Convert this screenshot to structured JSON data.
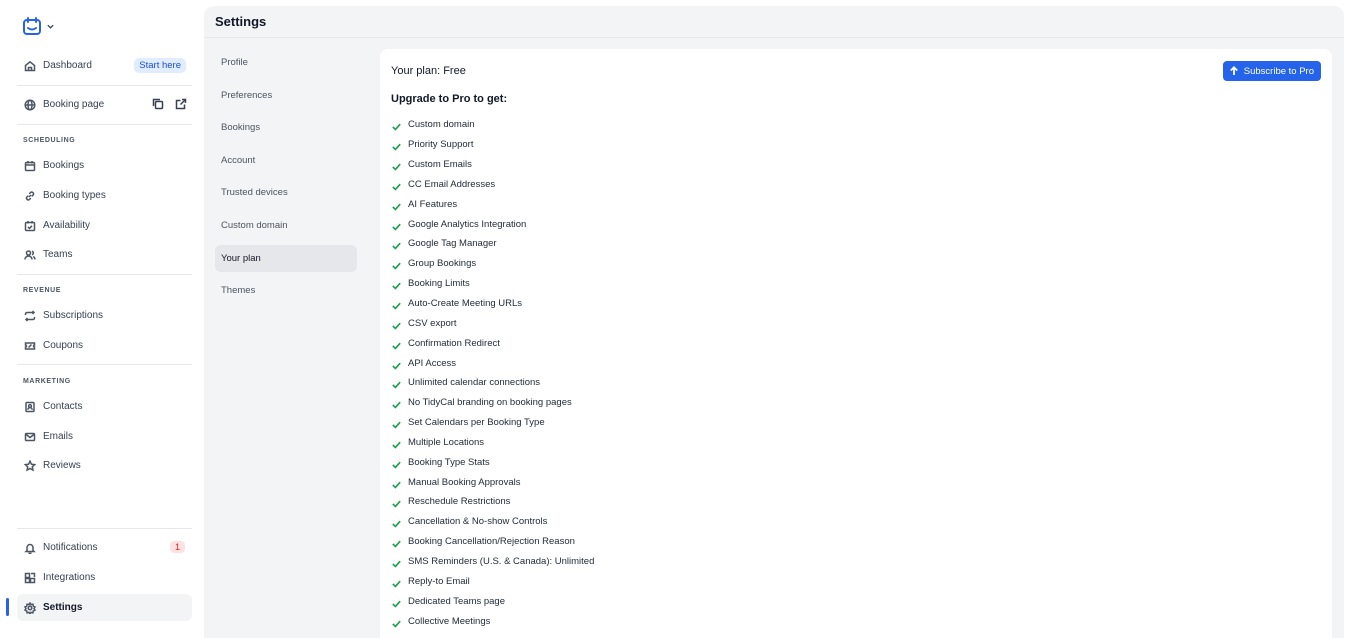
{
  "sidebar": {
    "dashboard": {
      "label": "Dashboard",
      "badge": "Start here"
    },
    "booking_page": {
      "label": "Booking page"
    },
    "sections": {
      "scheduling": "SCHEDULING",
      "revenue": "REVENUE",
      "marketing": "MARKETING"
    },
    "items": {
      "bookings": "Bookings",
      "booking_types": "Booking types",
      "availability": "Availability",
      "teams": "Teams",
      "subscriptions": "Subscriptions",
      "coupons": "Coupons",
      "contacts": "Contacts",
      "emails": "Emails",
      "reviews": "Reviews",
      "notifications": "Notifications",
      "notifications_count": "1",
      "integrations": "Integrations",
      "settings": "Settings"
    }
  },
  "header": {
    "title": "Settings"
  },
  "settings_nav": [
    {
      "label": "Profile"
    },
    {
      "label": "Preferences"
    },
    {
      "label": "Bookings"
    },
    {
      "label": "Account"
    },
    {
      "label": "Trusted devices"
    },
    {
      "label": "Custom domain"
    },
    {
      "label": "Your plan",
      "active": true
    },
    {
      "label": "Themes"
    }
  ],
  "plan": {
    "title": "Your plan: Free",
    "subscribe_label": "Subscribe to Pro",
    "upgrade_title": "Upgrade to Pro to get:",
    "features": [
      "Custom domain",
      "Priority Support",
      "Custom Emails",
      "CC Email Addresses",
      "AI Features",
      "Google Analytics Integration",
      "Google Tag Manager",
      "Group Bookings",
      "Booking Limits",
      "Auto-Create Meeting URLs",
      "CSV export",
      "Confirmation Redirect",
      "API Access",
      "Unlimited calendar connections",
      "No TidyCal branding on booking pages",
      "Set Calendars per Booking Type",
      "Multiple Locations",
      "Booking Type Stats",
      "Manual Booking Approvals",
      "Reschedule Restrictions",
      "Cancellation & No-show Controls",
      "Booking Cancellation/Rejection Reason",
      "SMS Reminders (U.S. & Canada): Unlimited",
      "Reply-to Email",
      "Dedicated Teams page",
      "Collective Meetings"
    ]
  },
  "colors": {
    "accent": "#2563eb",
    "check": "#16a34a",
    "badge_bg": "#e0ecff",
    "alert": "#dc2626"
  }
}
